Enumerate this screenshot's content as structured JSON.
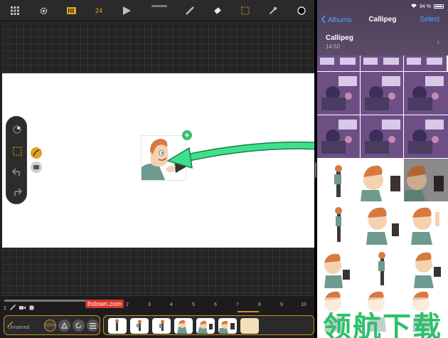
{
  "toolbar": {
    "fps": "24",
    "items": [
      "grid-icon",
      "gear-icon",
      "film-icon",
      "fps",
      "play-icon",
      "pencil-icon",
      "eraser-icon",
      "selection-icon",
      "eyedropper-icon",
      "color-swatch"
    ]
  },
  "timeline": {
    "layer_number": "2",
    "layer_name": "Unnamed",
    "opacity": "100%",
    "frame_numbers": [
      "1",
      "2",
      "3",
      "4",
      "5",
      "6",
      "7",
      "8",
      "9",
      "10"
    ]
  },
  "photos": {
    "status_battery": "94 %",
    "back_label": "Albums",
    "title": "Callipeg",
    "select_label": "Select",
    "album_name": "Callipeg",
    "album_time": "14:50"
  },
  "watermark": {
    "site": "lhdown.com",
    "text": "领航下载"
  },
  "colors": {
    "accent": "#e0a21e",
    "arrow": "#3fe08a",
    "ios_blue": "#4aa8ff",
    "add_badge": "#39c06a"
  }
}
